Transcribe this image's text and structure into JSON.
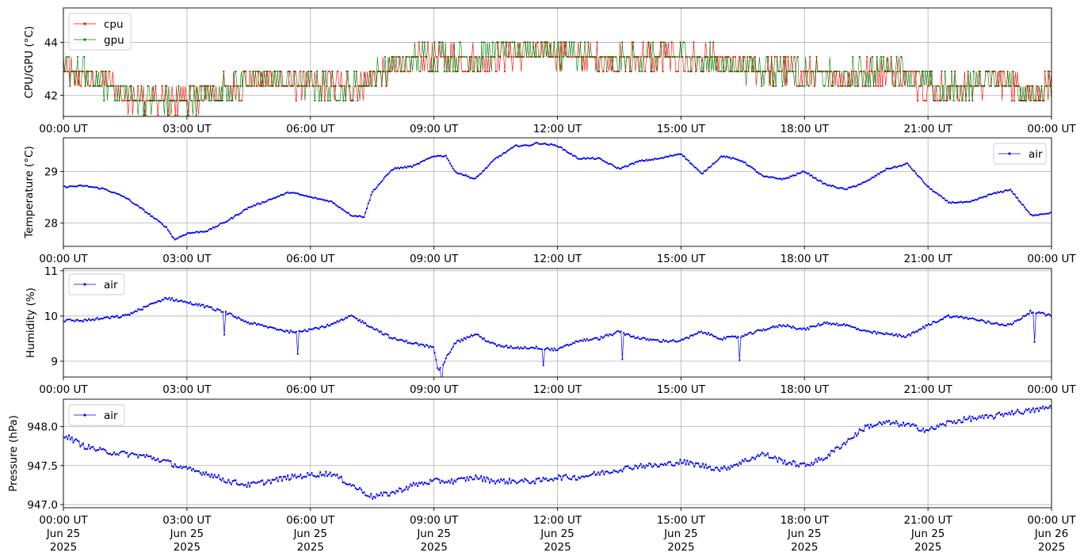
{
  "chart_data": [
    {
      "type": "line",
      "ylabel": "CPU/GPU (°C)",
      "ylim": [
        41.2,
        45.3
      ],
      "yticks": [
        42,
        44
      ],
      "grid": true,
      "legend_placement": "top-left",
      "x_range": [
        "2025-06-25 00:00",
        "2025-06-26 00:00"
      ],
      "x_tick_labels": [
        "00:00 UT",
        "03:00 UT",
        "06:00 UT",
        "09:00 UT",
        "12:00 UT",
        "15:00 UT",
        "18:00 UT",
        "21:00 UT",
        "00:00 UT"
      ],
      "series": [
        {
          "name": "cpu",
          "color": "#ff0000",
          "x_hours": [
            0,
            0.5,
            1,
            1.5,
            2,
            2.5,
            3,
            3.5,
            4,
            4.5,
            5,
            5.5,
            6,
            6.5,
            7,
            7.5,
            8,
            8.5,
            9,
            9.5,
            10,
            10.5,
            11,
            11.5,
            12,
            12.5,
            13,
            13.5,
            14,
            14.5,
            15,
            15.5,
            16,
            16.5,
            17,
            17.5,
            18,
            18.5,
            19,
            19.5,
            20,
            20.5,
            21,
            21.5,
            22,
            22.5,
            23,
            23.5,
            24
          ],
          "values": [
            42.9,
            42.7,
            42.5,
            42.0,
            41.9,
            41.8,
            41.9,
            42.0,
            42.2,
            42.5,
            42.6,
            42.5,
            42.4,
            42.4,
            42.3,
            42.6,
            43.0,
            43.2,
            43.4,
            43.4,
            43.3,
            43.5,
            43.6,
            43.6,
            43.6,
            43.4,
            43.3,
            43.3,
            43.4,
            43.4,
            43.4,
            43.3,
            43.2,
            43.1,
            43.0,
            42.9,
            42.8,
            42.7,
            42.6,
            42.8,
            43.0,
            42.8,
            42.3,
            42.2,
            42.3,
            42.6,
            42.5,
            42.1,
            42.3
          ]
        },
        {
          "name": "gpu",
          "color": "#008000",
          "x_hours": [
            0,
            0.5,
            1,
            1.5,
            2,
            2.5,
            3,
            3.5,
            4,
            4.5,
            5,
            5.5,
            6,
            6.5,
            7,
            7.5,
            8,
            8.5,
            9,
            9.5,
            10,
            10.5,
            11,
            11.5,
            12,
            12.5,
            13,
            13.5,
            14,
            14.5,
            15,
            15.5,
            16,
            16.5,
            17,
            17.5,
            18,
            18.5,
            19,
            19.5,
            20,
            20.5,
            21,
            21.5,
            22,
            22.5,
            23,
            23.5,
            24
          ],
          "values": [
            43.1,
            42.8,
            42.4,
            42.0,
            41.8,
            41.7,
            41.8,
            42.0,
            42.3,
            42.6,
            42.6,
            42.5,
            42.4,
            42.3,
            42.3,
            42.7,
            43.1,
            43.3,
            43.5,
            43.5,
            43.4,
            43.6,
            43.7,
            43.7,
            43.6,
            43.5,
            43.3,
            43.3,
            43.4,
            43.5,
            43.5,
            43.3,
            43.2,
            43.1,
            43.0,
            42.9,
            42.8,
            42.7,
            42.7,
            42.9,
            43.1,
            42.8,
            42.3,
            42.2,
            42.4,
            42.7,
            42.5,
            42.1,
            42.2
          ]
        }
      ]
    },
    {
      "type": "line",
      "ylabel": "Temperature (°C)",
      "ylim": [
        27.55,
        29.65
      ],
      "yticks": [
        28,
        29
      ],
      "grid": true,
      "legend_placement": "top-right",
      "x_range": [
        "2025-06-25 00:00",
        "2025-06-26 00:00"
      ],
      "x_tick_labels": [
        "00:00 UT",
        "03:00 UT",
        "06:00 UT",
        "09:00 UT",
        "12:00 UT",
        "15:00 UT",
        "18:00 UT",
        "21:00 UT",
        "00:00 UT"
      ],
      "series": [
        {
          "name": "air",
          "color": "#0000ff",
          "x_hours": [
            0,
            0.5,
            1,
            1.5,
            2,
            2.5,
            2.7,
            3,
            3.5,
            4,
            4.5,
            5,
            5.5,
            6,
            6.5,
            7,
            7.3,
            7.5,
            8,
            8.5,
            9,
            9.3,
            9.5,
            10,
            10.5,
            11,
            11.3,
            11.5,
            12,
            12.5,
            13,
            13.5,
            14,
            14.5,
            15,
            15.5,
            16,
            16.5,
            17,
            17.5,
            18,
            18.5,
            19,
            19.5,
            20,
            20.3,
            20.5,
            21,
            21.5,
            22,
            22.5,
            23,
            23.5,
            24
          ],
          "values": [
            28.7,
            28.72,
            28.66,
            28.5,
            28.22,
            27.92,
            27.68,
            27.8,
            27.85,
            28.05,
            28.3,
            28.45,
            28.6,
            28.5,
            28.42,
            28.15,
            28.12,
            28.6,
            29.05,
            29.1,
            29.3,
            29.3,
            29.0,
            28.85,
            29.25,
            29.5,
            29.5,
            29.55,
            29.5,
            29.25,
            29.25,
            29.05,
            29.2,
            29.25,
            29.35,
            28.95,
            29.3,
            29.2,
            28.9,
            28.85,
            29.0,
            28.75,
            28.65,
            28.8,
            29.05,
            29.1,
            29.15,
            28.7,
            28.4,
            28.4,
            28.55,
            28.65,
            28.15,
            28.2
          ]
        }
      ]
    },
    {
      "type": "line",
      "ylabel": "Humidity (%)",
      "ylim": [
        8.65,
        11.05
      ],
      "yticks": [
        9,
        10,
        11
      ],
      "grid": true,
      "legend_placement": "top-left",
      "x_range": [
        "2025-06-25 00:00",
        "2025-06-26 00:00"
      ],
      "x_tick_labels": [
        "00:00 UT",
        "03:00 UT",
        "06:00 UT",
        "09:00 UT",
        "12:00 UT",
        "15:00 UT",
        "18:00 UT",
        "21:00 UT",
        "00:00 UT"
      ],
      "series": [
        {
          "name": "air",
          "color": "#0000ff",
          "x_hours": [
            0,
            0.5,
            1,
            1.5,
            2,
            2.5,
            3,
            3.5,
            4,
            4.5,
            5,
            5.5,
            6,
            6.5,
            7,
            7.5,
            8,
            8.5,
            9,
            9.1,
            9.5,
            10,
            10.5,
            11,
            11.5,
            12,
            12.5,
            13,
            13.5,
            14,
            14.5,
            15,
            15.5,
            16,
            16.5,
            17,
            17.5,
            18,
            18.5,
            19,
            19.5,
            20,
            20.5,
            21,
            21.5,
            22,
            22.5,
            23,
            23.5,
            24
          ],
          "values": [
            9.9,
            9.9,
            9.95,
            10.0,
            10.2,
            10.4,
            10.3,
            10.2,
            10.05,
            9.85,
            9.75,
            9.65,
            9.7,
            9.8,
            10.0,
            9.75,
            9.5,
            9.4,
            9.3,
            8.75,
            9.4,
            9.6,
            9.35,
            9.3,
            9.3,
            9.25,
            9.45,
            9.5,
            9.65,
            9.5,
            9.45,
            9.45,
            9.65,
            9.5,
            9.55,
            9.7,
            9.8,
            9.7,
            9.85,
            9.8,
            9.65,
            9.6,
            9.55,
            9.8,
            10.0,
            9.95,
            9.85,
            9.8,
            10.1,
            10.0
          ]
        }
      ]
    },
    {
      "type": "line",
      "ylabel": "Pressure (hPa)",
      "ylim": [
        946.96,
        948.35
      ],
      "yticks": [
        947.0,
        947.5,
        948.0
      ],
      "ytick_labels": [
        "947.0",
        "947.5",
        "948.0"
      ],
      "grid": true,
      "legend_placement": "top-left",
      "x_range": [
        "2025-06-25 00:00",
        "2025-06-26 00:00"
      ],
      "x_tick_labels": [
        [
          "00:00 UT",
          "Jun 25",
          "2025"
        ],
        [
          "03:00 UT",
          "Jun 25",
          "2025"
        ],
        [
          "06:00 UT",
          "Jun 25",
          "2025"
        ],
        [
          "09:00 UT",
          "Jun 25",
          "2025"
        ],
        [
          "12:00 UT",
          "Jun 25",
          "2025"
        ],
        [
          "15:00 UT",
          "Jun 25",
          "2025"
        ],
        [
          "18:00 UT",
          "Jun 25",
          "2025"
        ],
        [
          "21:00 UT",
          "Jun 25",
          "2025"
        ],
        [
          "00:00 UT",
          "Jun 26",
          "2025"
        ]
      ],
      "series": [
        {
          "name": "air",
          "color": "#0000ff",
          "x_hours": [
            0,
            0.5,
            1,
            1.5,
            2,
            2.5,
            3,
            3.5,
            4,
            4.5,
            5,
            5.5,
            6,
            6.5,
            7,
            7.5,
            8,
            8.5,
            9,
            9.5,
            10,
            10.5,
            11,
            11.5,
            12,
            12.5,
            13,
            13.5,
            14,
            14.5,
            15,
            15.5,
            16,
            16.5,
            17,
            17.5,
            18,
            18.5,
            19,
            19.5,
            20,
            20.5,
            21,
            21.5,
            22,
            22.5,
            23,
            23.5,
            24
          ],
          "values": [
            947.9,
            947.75,
            947.68,
            947.65,
            947.62,
            947.55,
            947.45,
            947.4,
            947.3,
            947.25,
            947.3,
            947.35,
            947.38,
            947.4,
            947.25,
            947.1,
            947.15,
            947.25,
            947.3,
            947.3,
            947.35,
            947.3,
            947.3,
            947.3,
            947.35,
            947.35,
            947.4,
            947.45,
            947.5,
            947.5,
            947.55,
            947.5,
            947.45,
            947.55,
            947.65,
            947.55,
            947.5,
            947.6,
            947.8,
            948.0,
            948.05,
            948.02,
            947.95,
            948.05,
            948.1,
            948.12,
            948.18,
            948.2,
            948.25
          ]
        }
      ]
    }
  ]
}
